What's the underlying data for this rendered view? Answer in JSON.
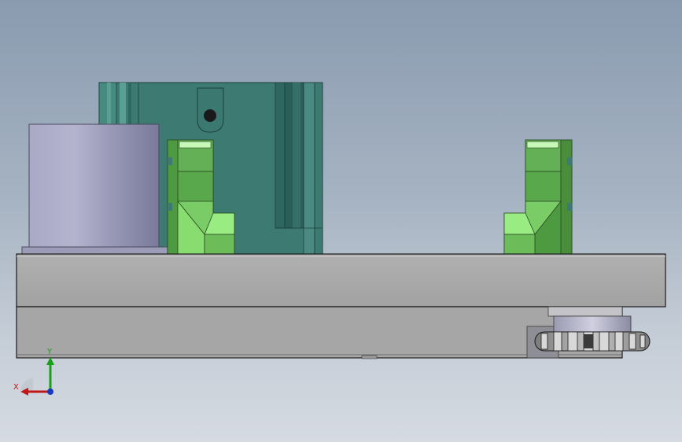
{
  "viewport": {
    "background_top": "#8a9bb0",
    "background_bottom": "#d6dbe2"
  },
  "model": {
    "colors": {
      "housing": "#3c7a72",
      "housing_dark": "#2c5e58",
      "cylinder": "#9a9ab8",
      "clamp_light": "#6cc05a",
      "clamp_mid": "#56a84a",
      "clamp_bright": "#9ef08a",
      "base_plate": "#a4a4a4",
      "gear": "#a8a8a8"
    }
  },
  "triad": {
    "x_label": "X",
    "y_label": "Y",
    "x_color": "#c01818",
    "y_color": "#18a018",
    "z_color": "#1838c0"
  }
}
